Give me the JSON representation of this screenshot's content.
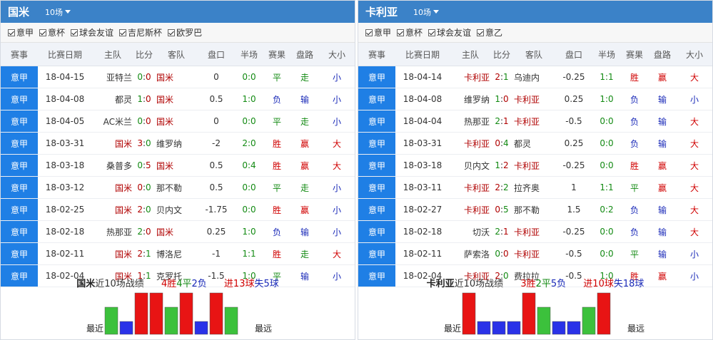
{
  "colors": {
    "header_bg": "#3b82c8",
    "comp_cell": "#1f7fe5",
    "win_red": "#d00000",
    "draw_green": "#138a13",
    "loss_blue": "#1a2ab8",
    "highlight_team": "#b00000",
    "bar_win": "#e81414",
    "bar_draw": "#3cc13c",
    "bar_loss": "#2a32e8"
  },
  "columns": [
    "赛事",
    "比赛日期",
    "主队",
    "比分",
    "客队",
    "盘口",
    "半场",
    "赛果",
    "盘路",
    "大小"
  ],
  "left": {
    "team": "国米",
    "count_label": "10场",
    "filters": [
      "意甲",
      "意杯",
      "球会友谊",
      "吉尼斯杯",
      "欧罗巴"
    ],
    "rows": [
      {
        "comp": "意甲",
        "date": "18-04-15",
        "home": "亚特兰",
        "score": "0:0",
        "away": "国米",
        "hand": "0",
        "half": "0:0",
        "result": "平",
        "handicap": "走",
        "ou": "小"
      },
      {
        "comp": "意甲",
        "date": "18-04-08",
        "home": "都灵",
        "score": "1:0",
        "away": "国米",
        "hand": "0.5",
        "half": "1:0",
        "result": "负",
        "handicap": "输",
        "ou": "小"
      },
      {
        "comp": "意甲",
        "date": "18-04-05",
        "home": "AC米兰",
        "score": "0:0",
        "away": "国米",
        "hand": "0",
        "half": "0:0",
        "result": "平",
        "handicap": "走",
        "ou": "小"
      },
      {
        "comp": "意甲",
        "date": "18-03-31",
        "home": "国米",
        "score": "3:0",
        "away": "维罗纳",
        "hand": "-2",
        "half": "2:0",
        "result": "胜",
        "handicap": "赢",
        "ou": "大"
      },
      {
        "comp": "意甲",
        "date": "18-03-18",
        "home": "桑普多",
        "score": "0:5",
        "away": "国米",
        "hand": "0.5",
        "half": "0:4",
        "result": "胜",
        "handicap": "赢",
        "ou": "大"
      },
      {
        "comp": "意甲",
        "date": "18-03-12",
        "home": "国米",
        "score": "0:0",
        "away": "那不勒",
        "hand": "0.5",
        "half": "0:0",
        "result": "平",
        "handicap": "走",
        "ou": "小"
      },
      {
        "comp": "意甲",
        "date": "18-02-25",
        "home": "国米",
        "score": "2:0",
        "away": "贝内文",
        "hand": "-1.75",
        "half": "0:0",
        "result": "胜",
        "handicap": "赢",
        "ou": "小"
      },
      {
        "comp": "意甲",
        "date": "18-02-18",
        "home": "热那亚",
        "score": "2:0",
        "away": "国米",
        "hand": "0.25",
        "half": "1:0",
        "result": "负",
        "handicap": "输",
        "ou": "小"
      },
      {
        "comp": "意甲",
        "date": "18-02-11",
        "home": "国米",
        "score": "2:1",
        "away": "博洛尼",
        "hand": "-1",
        "half": "1:1",
        "result": "胜",
        "handicap": "走",
        "ou": "大"
      },
      {
        "comp": "意甲",
        "date": "18-02-04",
        "home": "国米",
        "score": "1:1",
        "away": "克罗托",
        "hand": "-1.5",
        "half": "1:0",
        "result": "平",
        "handicap": "输",
        "ou": "小"
      }
    ],
    "summary": {
      "label": "近10场战绩",
      "w": "4胜",
      "d": "4平",
      "l": "2负",
      "goals_for": "进13球",
      "goals_against": "失5球"
    },
    "form": [
      "draw",
      "loss",
      "win",
      "win",
      "draw",
      "win",
      "loss",
      "win",
      "draw"
    ],
    "recent_label": "最近",
    "far_label": "最远"
  },
  "right": {
    "team": "卡利亚",
    "count_label": "10场",
    "filters": [
      "意甲",
      "意杯",
      "球会友谊",
      "意乙"
    ],
    "rows": [
      {
        "comp": "意甲",
        "date": "18-04-14",
        "home": "卡利亚",
        "score": "2:1",
        "away": "乌迪内",
        "hand": "-0.25",
        "half": "1:1",
        "result": "胜",
        "handicap": "赢",
        "ou": "大"
      },
      {
        "comp": "意甲",
        "date": "18-04-08",
        "home": "维罗纳",
        "score": "1:0",
        "away": "卡利亚",
        "hand": "0.25",
        "half": "1:0",
        "result": "负",
        "handicap": "输",
        "ou": "小"
      },
      {
        "comp": "意甲",
        "date": "18-04-04",
        "home": "热那亚",
        "score": "2:1",
        "away": "卡利亚",
        "hand": "-0.5",
        "half": "0:0",
        "result": "负",
        "handicap": "输",
        "ou": "大"
      },
      {
        "comp": "意甲",
        "date": "18-03-31",
        "home": "卡利亚",
        "score": "0:4",
        "away": "都灵",
        "hand": "0.25",
        "half": "0:0",
        "result": "负",
        "handicap": "输",
        "ou": "大"
      },
      {
        "comp": "意甲",
        "date": "18-03-18",
        "home": "贝内文",
        "score": "1:2",
        "away": "卡利亚",
        "hand": "-0.25",
        "half": "0:0",
        "result": "胜",
        "handicap": "赢",
        "ou": "大"
      },
      {
        "comp": "意甲",
        "date": "18-03-11",
        "home": "卡利亚",
        "score": "2:2",
        "away": "拉齐奥",
        "hand": "1",
        "half": "1:1",
        "result": "平",
        "handicap": "赢",
        "ou": "大"
      },
      {
        "comp": "意甲",
        "date": "18-02-27",
        "home": "卡利亚",
        "score": "0:5",
        "away": "那不勒",
        "hand": "1.5",
        "half": "0:2",
        "result": "负",
        "handicap": "输",
        "ou": "大"
      },
      {
        "comp": "意甲",
        "date": "18-02-18",
        "home": "切沃",
        "score": "2:1",
        "away": "卡利亚",
        "hand": "-0.25",
        "half": "0:0",
        "result": "负",
        "handicap": "输",
        "ou": "大"
      },
      {
        "comp": "意甲",
        "date": "18-02-11",
        "home": "萨索洛",
        "score": "0:0",
        "away": "卡利亚",
        "hand": "-0.5",
        "half": "0:0",
        "result": "平",
        "handicap": "输",
        "ou": "小"
      },
      {
        "comp": "意甲",
        "date": "18-02-04",
        "home": "卡利亚",
        "score": "2:0",
        "away": "费拉拉",
        "hand": "-0.5",
        "half": "1:0",
        "result": "胜",
        "handicap": "赢",
        "ou": "小"
      }
    ],
    "summary": {
      "label": "近10场战绩",
      "w": "3胜",
      "d": "2平",
      "l": "5负",
      "goals_for": "进10球",
      "goals_against": "失18球"
    },
    "form": [
      "win",
      "loss",
      "loss",
      "loss",
      "win",
      "draw",
      "loss",
      "loss",
      "draw",
      "win"
    ],
    "recent_label": "最近",
    "far_label": "最远"
  }
}
